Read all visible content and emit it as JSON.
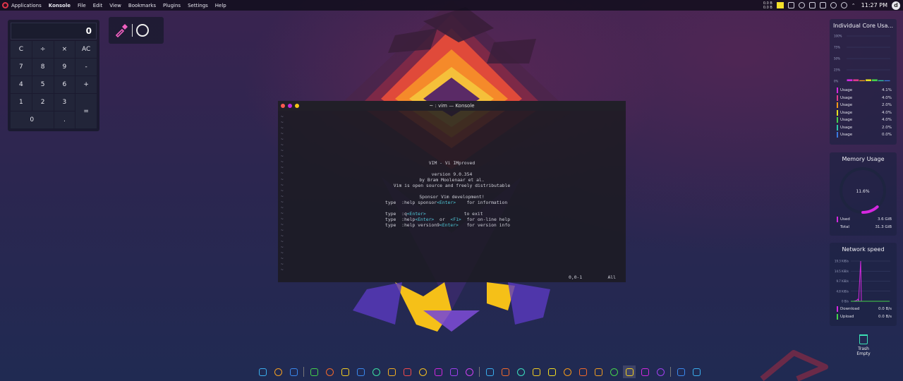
{
  "topbar": {
    "menus": [
      "Applications",
      "Konsole",
      "File",
      "Edit",
      "View",
      "Bookmarks",
      "Plugins",
      "Settings",
      "Help"
    ],
    "net_up": "0.0 B",
    "net_down": "0.0 B",
    "clock": "11:27 PM",
    "user_initial": "d",
    "tray_icons": [
      "network-upload-icon",
      "play-icon",
      "volume-icon",
      "screen-icon",
      "bluetooth-icon",
      "wifi-icon",
      "chevron-up-icon"
    ]
  },
  "calculator": {
    "display": "0",
    "keys": [
      "C",
      "÷",
      "×",
      "AC",
      "7",
      "8",
      "9",
      "-",
      "4",
      "5",
      "6",
      "+",
      "1",
      "2",
      "3",
      "=",
      "0",
      "."
    ]
  },
  "color_picker": {
    "icons": [
      "eyedropper-icon",
      "circle-icon"
    ]
  },
  "konsole": {
    "title": "~ : vim — Konsole",
    "traffic_colors": [
      "#ff5a52",
      "#c028e0",
      "#f5c518"
    ],
    "tilde": "~",
    "lines": {
      "l1": "VIM - Vi IMproved",
      "l2": "version 9.0.354",
      "l3": "by Bram Moolenaar et al.",
      "l4": "Vim is open source and freely distributable",
      "l5": "Sponsor Vim development!",
      "type": "type",
      "help_sponsor": ":help sponsor",
      "enter": "<Enter>",
      "for_information": "for information",
      "q": ":q",
      "to_exit": "to exit",
      "help": ":help",
      "or": "or",
      "f1": "<F1>",
      "for_online_help": "for on-line help",
      "help_version": ":help version9",
      "for_version_info": "for version info"
    },
    "cursor_pos": "0,0-1",
    "scroll": "All"
  },
  "core_widget": {
    "title": "Individual Core Usa...",
    "axis": [
      "100%",
      "75%",
      "50%",
      "25%",
      "0%"
    ],
    "label": "Usage",
    "cores": [
      {
        "value": "4.1%",
        "color": "#d428e0"
      },
      {
        "value": "4.0%",
        "color": "#e03a8a"
      },
      {
        "value": "2.0%",
        "color": "#f59a18"
      },
      {
        "value": "4.0%",
        "color": "#e8e020"
      },
      {
        "value": "4.0%",
        "color": "#44d24a"
      },
      {
        "value": "2.0%",
        "color": "#2ec4a8"
      },
      {
        "value": "0.0%",
        "color": "#3a7ae0"
      }
    ]
  },
  "memory_widget": {
    "title": "Memory Usage",
    "percent": "11.6%",
    "used_fraction": 0.116,
    "used_label": "Used",
    "used_value": "3.6 GiB",
    "total_label": "Total",
    "total_value": "31.3 GiB",
    "accent": "#d428e0"
  },
  "network_widget": {
    "title": "Network speed",
    "axis": [
      "19.3 KiB/s",
      "14.5 KiB/s",
      "9.7 KiB/s",
      "4.8 KiB/s",
      "0 B/s"
    ],
    "download_label": "Download",
    "download_value": "0.0 B/s",
    "upload_label": "Upload",
    "upload_value": "0.0 B/s",
    "download_color": "#d428e0",
    "upload_color": "#44d24a"
  },
  "trash": {
    "label": "Trash",
    "status": "Empty"
  },
  "dock": {
    "apps": [
      {
        "name": "image-viewer-icon",
        "color": "#3ab0f0"
      },
      {
        "name": "brave-icon",
        "color": "#f5a020"
      },
      {
        "name": "browser-icon",
        "color": "#3a8af0"
      },
      {
        "name": "notes-icon",
        "color": "#44d24a"
      },
      {
        "name": "files-icon",
        "color": "#f56a2a"
      },
      {
        "name": "bitwarden-icon",
        "color": "#f5d020"
      },
      {
        "name": "messenger-icon",
        "color": "#3a8af0"
      },
      {
        "name": "vim-icon",
        "color": "#3be0a0"
      },
      {
        "name": "editor-icon",
        "color": "#f5b020"
      },
      {
        "name": "tools-icon",
        "color": "#f54a4a"
      },
      {
        "name": "stats-icon",
        "color": "#f5c020"
      },
      {
        "name": "ghost-icon",
        "color": "#d428e0"
      },
      {
        "name": "tor-icon",
        "color": "#a040f0"
      },
      {
        "name": "obs-icon",
        "color": "#d040f0"
      },
      {
        "name": "chrome-icon",
        "color": "#3ab0f0"
      },
      {
        "name": "firefox-icon",
        "color": "#f56a2a"
      },
      {
        "name": "globe-icon",
        "color": "#3be0c0"
      },
      {
        "name": "grid-icon",
        "color": "#f5d020"
      },
      {
        "name": "chromium-icon",
        "color": "#f5e020"
      },
      {
        "name": "vlc-icon",
        "color": "#f59a18"
      },
      {
        "name": "gimp-icon",
        "color": "#f56a2a"
      },
      {
        "name": "krita-icon",
        "color": "#f5a020"
      },
      {
        "name": "nvidia-icon",
        "color": "#44d24a"
      },
      {
        "name": "terminal-icon",
        "color": "#f5d020"
      },
      {
        "name": "store-icon",
        "color": "#d428e0"
      },
      {
        "name": "settings-icon",
        "color": "#a040f0"
      },
      {
        "name": "word-icon",
        "color": "#3a8af0"
      },
      {
        "name": "chrome-alt-icon",
        "color": "#3ab0f0"
      }
    ]
  }
}
